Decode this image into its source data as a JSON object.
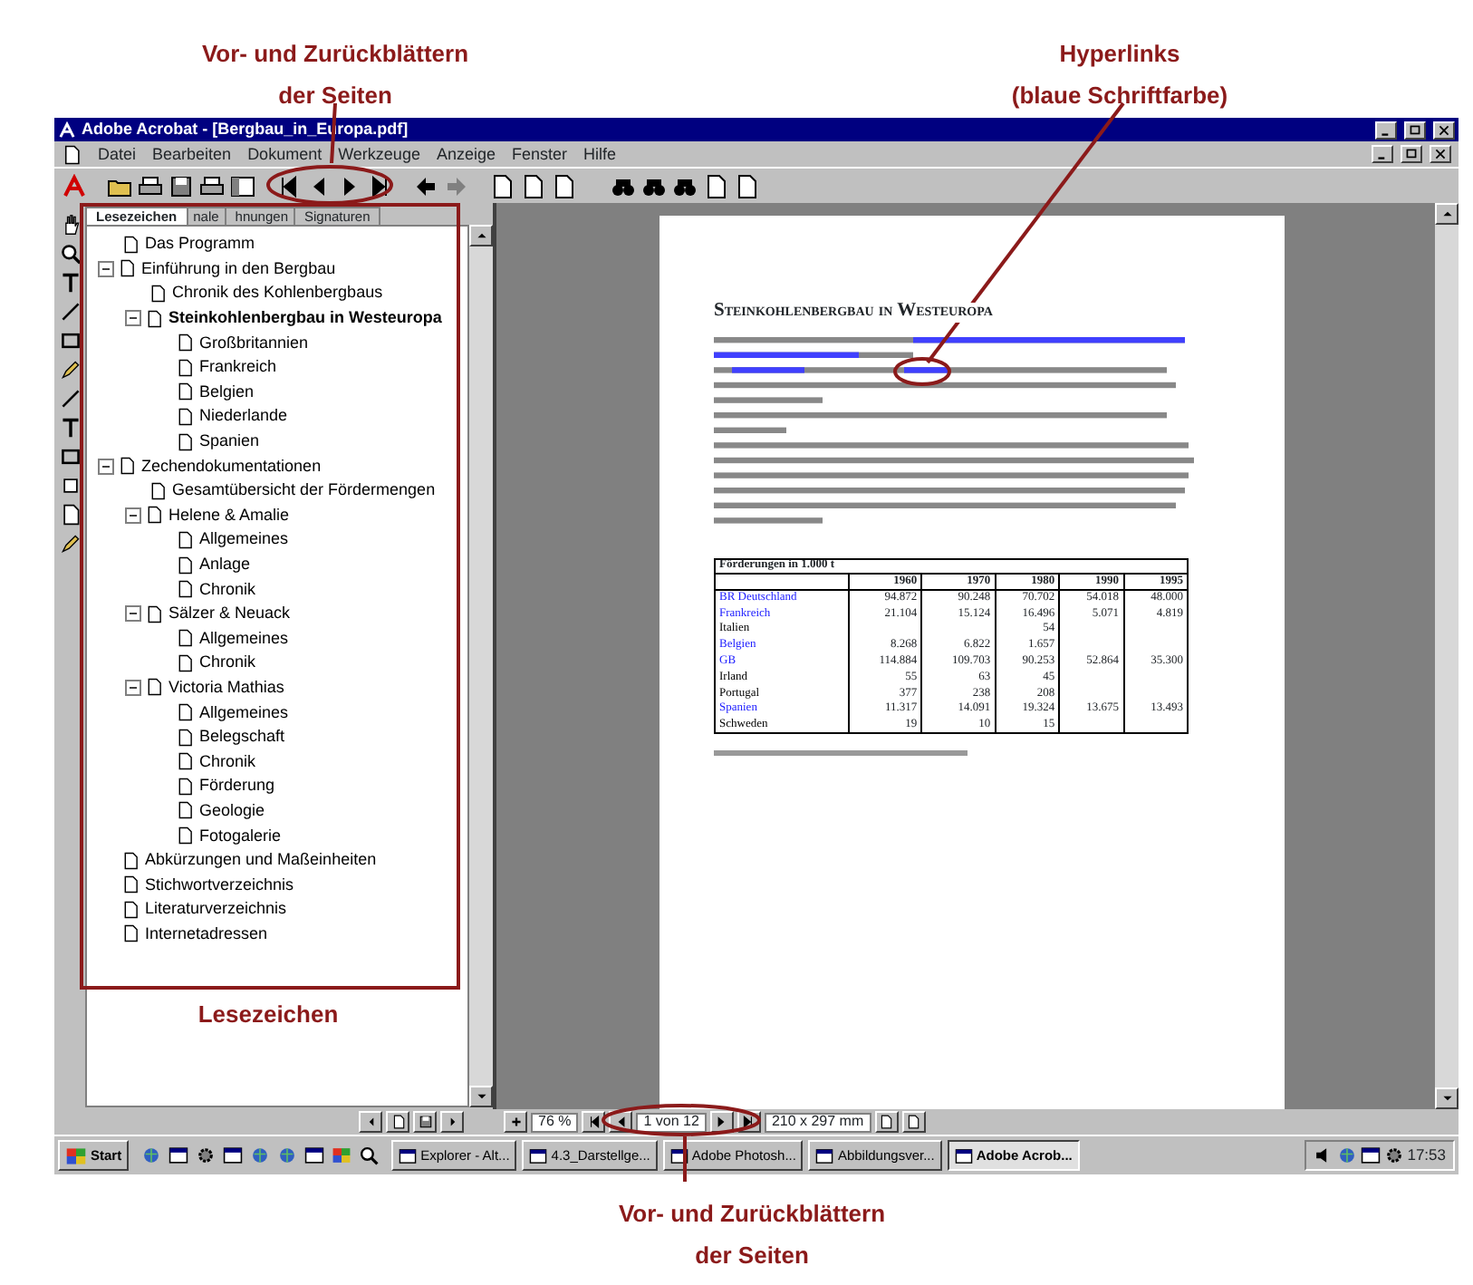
{
  "callouts": [
    {
      "lines": [
        "Vor- und Zurückblättern",
        "der Seiten"
      ]
    },
    {
      "lines": [
        "Hyperlinks",
        "(blaue Schriftfarbe)"
      ]
    },
    {
      "lines": [
        "Lesezeichen"
      ]
    },
    {
      "lines": [
        "Vor- und Zurückblättern",
        "der Seiten"
      ]
    }
  ],
  "window": {
    "title": "Adobe Acrobat - [Bergbau_in_Europa.pdf]"
  },
  "menu": [
    "Datei",
    "Bearbeiten",
    "Dokument",
    "Werkzeuge",
    "Anzeige",
    "Fenster",
    "Hilfe"
  ],
  "panel_tabs": [
    {
      "label": "Lesezeichen",
      "selected": true
    },
    {
      "label": "nale",
      "selected": false
    },
    {
      "label": "hnungen",
      "selected": false
    },
    {
      "label": "Signaturen",
      "selected": false
    }
  ],
  "bookmarks": [
    {
      "label": "Das Programm",
      "selected": false
    },
    {
      "label": "Einführung in den Bergbau",
      "selected": false,
      "expanded": true,
      "children": [
        {
          "label": "Chronik des Kohlenbergbaus",
          "selected": false
        },
        {
          "label": "Steinkohlenbergbau in Westeuropa",
          "selected": true,
          "expanded": true,
          "children": [
            {
              "label": "Großbritannien",
              "selected": false
            },
            {
              "label": "Frankreich",
              "selected": false
            },
            {
              "label": "Belgien",
              "selected": false
            },
            {
              "label": "Niederlande",
              "selected": false
            },
            {
              "label": "Spanien",
              "selected": false
            }
          ]
        }
      ]
    },
    {
      "label": "Zechendokumentationen",
      "selected": false,
      "expanded": true,
      "children": [
        {
          "label": "Gesamtübersicht der Fördermengen",
          "selected": false
        },
        {
          "label": "Helene & Amalie",
          "selected": false,
          "expanded": true,
          "children": [
            {
              "label": "Allgemeines",
              "selected": false
            },
            {
              "label": "Anlage",
              "selected": false
            },
            {
              "label": "Chronik",
              "selected": false
            }
          ]
        },
        {
          "label": "Sälzer & Neuack",
          "selected": false,
          "expanded": true,
          "children": [
            {
              "label": "Allgemeines",
              "selected": false
            },
            {
              "label": "Chronik",
              "selected": false
            }
          ]
        },
        {
          "label": "Victoria Mathias",
          "selected": false,
          "expanded": true,
          "children": [
            {
              "label": "Allgemeines",
              "selected": false
            },
            {
              "label": "Belegschaft",
              "selected": false
            },
            {
              "label": "Chronik",
              "selected": false
            },
            {
              "label": "Förderung",
              "selected": false
            },
            {
              "label": "Geologie",
              "selected": false
            },
            {
              "label": "Fotogalerie",
              "selected": false
            }
          ]
        }
      ]
    },
    {
      "label": "Abkürzungen und Maßeinheiten",
      "selected": false
    },
    {
      "label": "Stichwortverzeichnis",
      "selected": false
    },
    {
      "label": "Literaturverzeichnis",
      "selected": false
    },
    {
      "label": "Internetadressen",
      "selected": false
    }
  ],
  "document": {
    "heading": "Steinkohlenbergbau in Westeuropa",
    "table": {
      "caption": "Förderungen in 1.000 t",
      "columns": [
        "1960",
        "1970",
        "1980",
        "1990",
        "1995"
      ],
      "rows": [
        {
          "label": "BR Deutschland",
          "link": true,
          "values": {
            "col_1": "94.872",
            "col_2": "90.248",
            "col_3": "70.702",
            "col_4": "54.018",
            "col_5": "48.000"
          }
        },
        {
          "label": "Frankreich",
          "link": true,
          "values": {
            "col_1": "21.104",
            "col_2": "15.124",
            "col_3": "16.496",
            "col_4": "5.071",
            "col_5": "4.819"
          }
        },
        {
          "label": "Italien",
          "link": false,
          "values": {
            "col_3": "54"
          }
        },
        {
          "label": "Belgien",
          "link": true,
          "values": {
            "col_1": "8.268",
            "col_2": "6.822",
            "col_3": "1.657"
          }
        },
        {
          "label": "GB",
          "link": true,
          "values": {
            "col_1": "114.884",
            "col_2": "109.703",
            "col_3": "90.253",
            "col_4": "52.864",
            "col_5": "35.300"
          }
        },
        {
          "label": "Irland",
          "link": false,
          "values": {
            "col_1": "55",
            "col_2": "63",
            "col_3": "45"
          }
        },
        {
          "label": "Portugal",
          "link": false,
          "values": {
            "col_1": "377",
            "col_2": "238",
            "col_3": "208"
          }
        },
        {
          "label": "Spanien",
          "link": true,
          "values": {
            "col_1": "11.317",
            "col_2": "14.091",
            "col_3": "19.324",
            "col_4": "13.675",
            "col_5": "13.493"
          }
        },
        {
          "label": "Schweden",
          "link": false,
          "values": {
            "col_1": "19",
            "col_2": "10",
            "col_3": "15"
          }
        }
      ]
    }
  },
  "status_bar": {
    "zoom": "76 %",
    "page": "1 von 12",
    "page_size": "210 x 297 mm"
  },
  "taskbar": {
    "start": "Start",
    "tasks": [
      {
        "label": "Explorer - Alt...",
        "selected": false
      },
      {
        "label": "4.3_Darstellge...",
        "selected": false
      },
      {
        "label": "Adobe Photosh...",
        "selected": false
      },
      {
        "label": "Abbildungsver...",
        "selected": false
      },
      {
        "label": "Adobe Acrob...",
        "selected": true
      }
    ],
    "clock": "17:53"
  }
}
